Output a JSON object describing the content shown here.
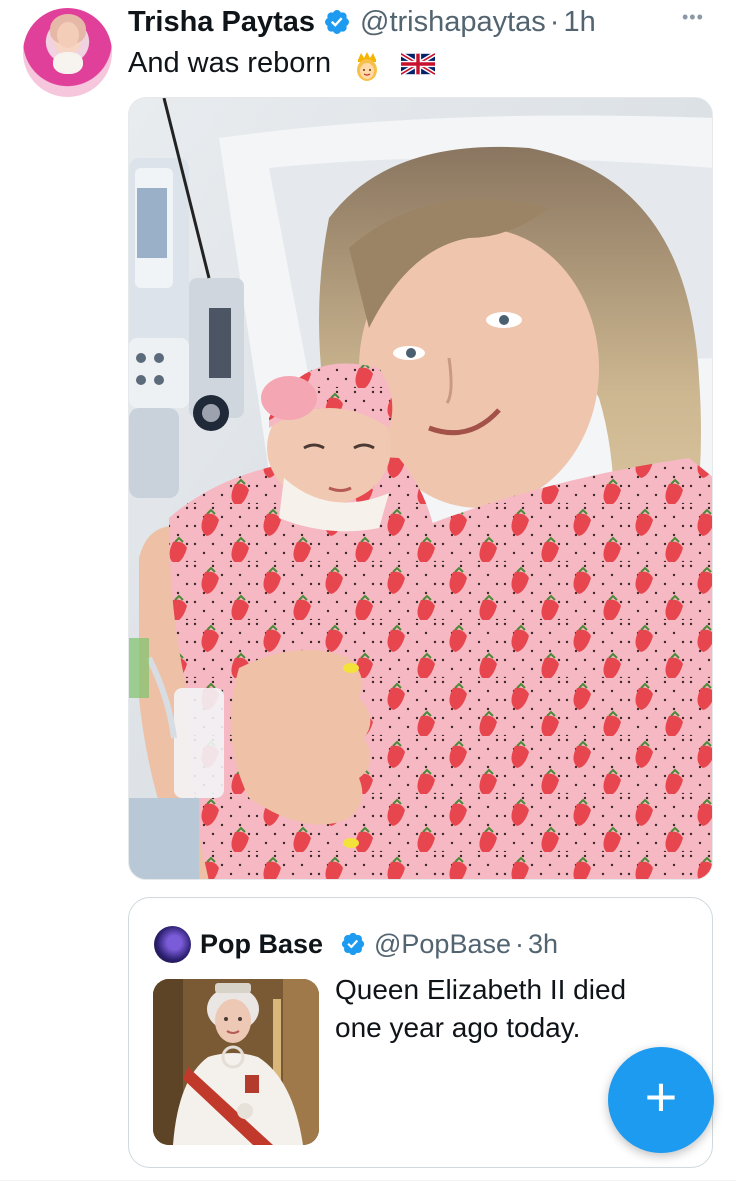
{
  "tweet": {
    "author_name": "Trisha Paytas",
    "author_handle": "@trishapaytas",
    "separator": "·",
    "timestamp": "1h",
    "text": "And was reborn",
    "emojis": [
      "crown-person-emoji",
      "uk-flag-emoji"
    ],
    "more_icon": "more-horizontal-icon"
  },
  "quoted_tweet": {
    "author_name": "Pop Base",
    "author_handle": "@PopBase",
    "separator": "·",
    "timestamp": "3h",
    "text": "Queen Elizabeth II died one year ago today."
  },
  "fab": {
    "label": "+",
    "icon": "compose-plus-icon"
  },
  "colors": {
    "accent": "#1d9bf0",
    "verified_badge": "#1d9bf0",
    "secondary_text": "#536471",
    "card_border": "#cfd9de"
  }
}
